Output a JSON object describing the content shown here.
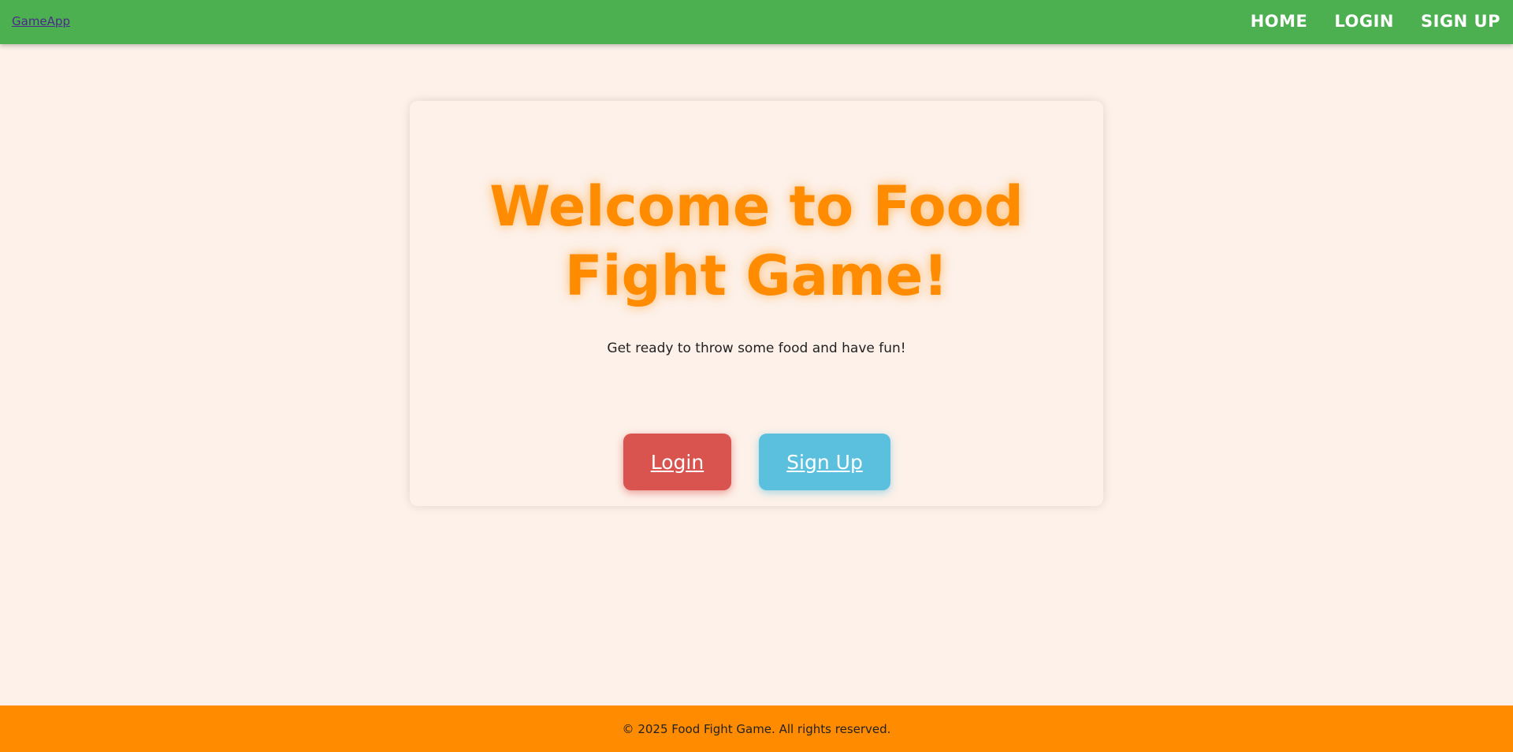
{
  "navbar": {
    "brand": "GameApp",
    "links": [
      "HOME",
      "LOGIN",
      "SIGN UP"
    ]
  },
  "hero": {
    "title": "Welcome to Food Fight Game!",
    "subtitle": "Get ready to throw some food and have fun!",
    "login_label": "Login",
    "signup_label": "Sign Up"
  },
  "footer": {
    "text": "© 2025 Food Fight Game. All rights reserved."
  },
  "colors": {
    "navbar": "#4caf50",
    "accent": "#ff8c00",
    "login_button": "#d9534f",
    "signup_button": "#5bc0de",
    "background": "#fdf1e9"
  }
}
